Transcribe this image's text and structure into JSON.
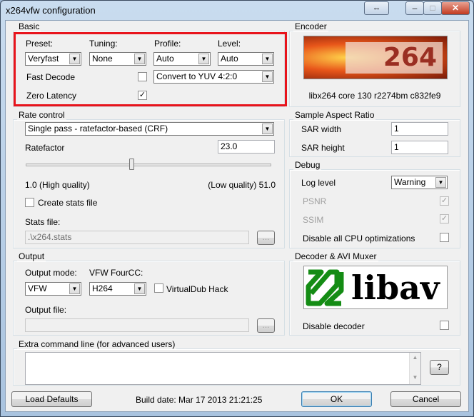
{
  "window": {
    "title": "x264vfw configuration",
    "swap_icon": "⇔",
    "min_icon": "–",
    "max_icon": "□",
    "close_icon": "✕"
  },
  "basic": {
    "label": "Basic",
    "preset_label": "Preset:",
    "tuning_label": "Tuning:",
    "profile_label": "Profile:",
    "level_label": "Level:",
    "preset": "Veryfast",
    "tuning": "None",
    "profile": "Auto",
    "level": "Auto",
    "fast_decode_label": "Fast Decode",
    "fast_decode": false,
    "zero_latency_label": "Zero Latency",
    "zero_latency": true,
    "colorspace": "Convert to YUV 4:2:0",
    "highlight_color": "#e8141c"
  },
  "encoder": {
    "label": "Encoder",
    "logo_text": "x264",
    "version": "libx264 core 130 r2274bm c832fe9"
  },
  "rate": {
    "label": "Rate control",
    "mode": "Single pass - ratefactor-based (CRF)",
    "ratefactor_label": "Ratefactor",
    "ratefactor": "23.0",
    "slider_fraction": 0.43,
    "min_label": "1.0 (High quality)",
    "max_label": "(Low quality) 51.0",
    "create_stats_label": "Create stats file",
    "create_stats": false,
    "stats_file_label": "Stats file:",
    "stats_file": ".\\x264.stats",
    "browse": "..."
  },
  "sar": {
    "label": "Sample Aspect Ratio",
    "width_label": "SAR width",
    "width": "1",
    "height_label": "SAR height",
    "height": "1"
  },
  "debug": {
    "label": "Debug",
    "log_level_label": "Log level",
    "log_level": "Warning",
    "psnr_label": "PSNR",
    "ssim_label": "SSIM",
    "cpu_label": "Disable all CPU optimizations",
    "check": "✓"
  },
  "output": {
    "label": "Output",
    "mode_label": "Output mode:",
    "fourcc_label": "VFW FourCC:",
    "mode": "VFW",
    "fourcc": "H264",
    "vdub_label": "VirtualDub Hack",
    "file_label": "Output file:",
    "browse": "..."
  },
  "decoder": {
    "label": "Decoder & AVI Muxer",
    "logo_text": "libav",
    "disable_label": "Disable decoder"
  },
  "extra": {
    "label": "Extra command line (for advanced users)",
    "help": "?"
  },
  "footer": {
    "load_defaults": "Load Defaults",
    "build_date": "Build date: Mar 17 2013 21:21:25",
    "ok": "OK",
    "cancel": "Cancel"
  }
}
